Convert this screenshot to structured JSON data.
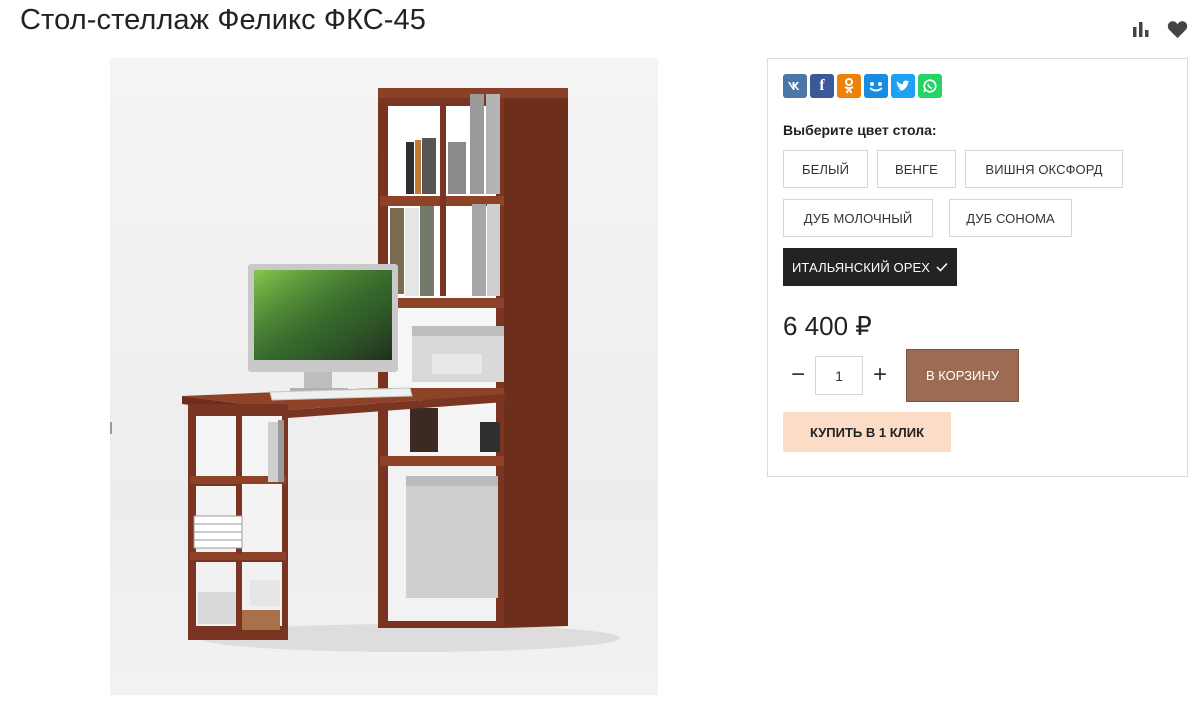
{
  "product": {
    "title": "Стол-стеллаж Феликс ФКС-45",
    "image_alt": "Стол-стеллаж Феликс ФКС-45"
  },
  "top_icons": [
    "compare-icon",
    "favorite-heart-icon"
  ],
  "share": [
    {
      "name": "vk",
      "label": "vk",
      "color": "#4a76a8"
    },
    {
      "name": "facebook",
      "label": "f",
      "color": "#3b5998"
    },
    {
      "name": "odnoklassniki",
      "label": "ok",
      "color": "#ee8208"
    },
    {
      "name": "moimir",
      "label": "@",
      "color": "#168de2"
    },
    {
      "name": "twitter",
      "label": "t",
      "color": "#1da1f2"
    },
    {
      "name": "whatsapp",
      "label": "w",
      "color": "#25d366"
    }
  ],
  "color_selector": {
    "label": "Выберите цвет стола:",
    "options": [
      {
        "label": "Белый",
        "selected": false
      },
      {
        "label": "Венге",
        "selected": false
      },
      {
        "label": "Вишня Оксфорд",
        "selected": false
      },
      {
        "label": "Дуб молочный",
        "selected": false
      },
      {
        "label": "Дуб Сонома",
        "selected": false
      },
      {
        "label": "Итальянский орех",
        "selected": true
      }
    ]
  },
  "price": "6 400 ₽",
  "quantity": {
    "minus": "−",
    "value": "1",
    "plus": "+"
  },
  "buttons": {
    "cart": "В КОРЗИНУ",
    "one_click": "КУПИТЬ В 1 КЛИК"
  },
  "colors": {
    "cart_bg": "#9c6b53",
    "one_click_bg": "#fcdcc6",
    "selected_option_bg": "#232323"
  }
}
